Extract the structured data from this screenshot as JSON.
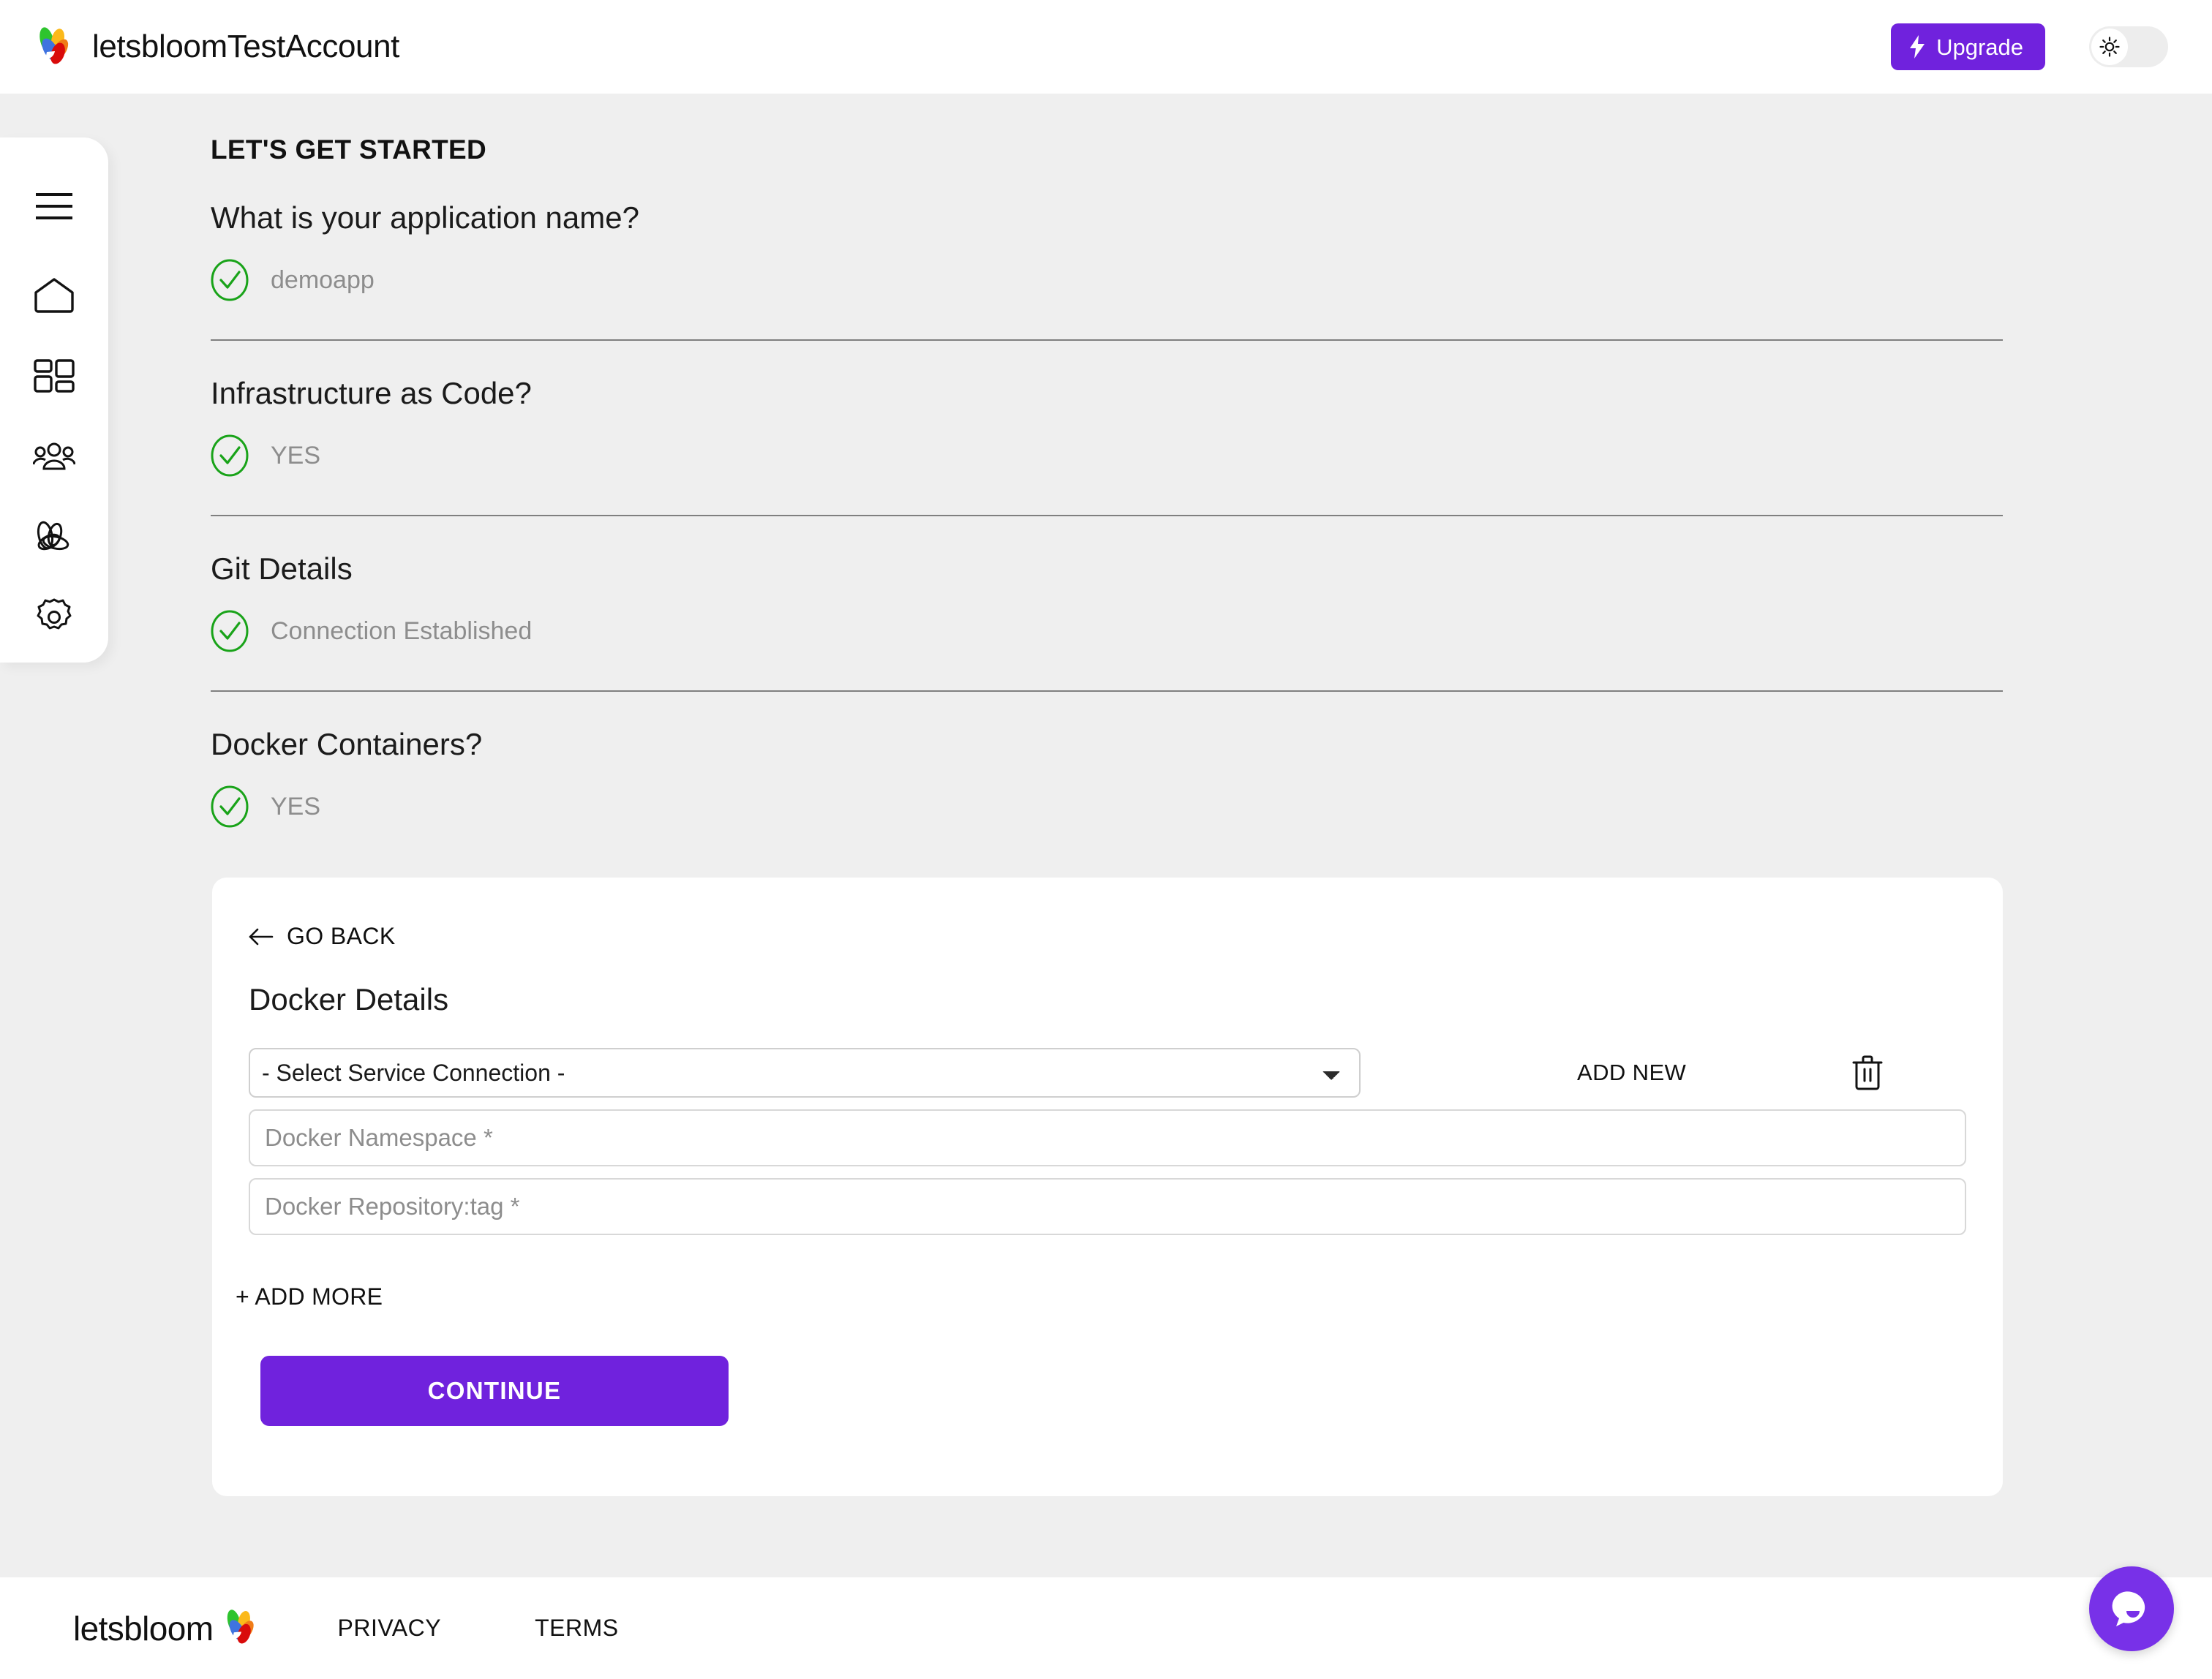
{
  "header": {
    "brand_name": "letsbloomTestAccount",
    "logo_icon": "bloom-petals-logo",
    "upgrade_label": "Upgrade",
    "upgrade_icon": "lightning-bolt-icon",
    "theme_toggle_icon": "sun-icon",
    "theme_toggle_state": "light"
  },
  "sidebar": {
    "items": [
      {
        "name": "menu",
        "icon": "hamburger-menu-icon"
      },
      {
        "name": "home",
        "icon": "home-icon"
      },
      {
        "name": "dashboard",
        "icon": "grid-dashboard-icon"
      },
      {
        "name": "teams",
        "icon": "users-group-icon"
      },
      {
        "name": "blooms",
        "icon": "bloom-petals-icon"
      },
      {
        "name": "settings",
        "icon": "gear-icon"
      }
    ]
  },
  "main": {
    "page_title": "LET'S GET STARTED",
    "sections": [
      {
        "question": "What is your application name?",
        "status_icon": "green-check-circle-icon",
        "answer": "demoapp",
        "divider_after": true
      },
      {
        "question": "Infrastructure as Code?",
        "status_icon": "green-check-circle-icon",
        "answer": "YES",
        "divider_after": true
      },
      {
        "question": "Git Details",
        "status_icon": "green-check-circle-icon",
        "answer": "Connection Established",
        "divider_after": true
      },
      {
        "question": "Docker Containers?",
        "status_icon": "green-check-circle-icon",
        "answer": "YES",
        "divider_after": false
      }
    ]
  },
  "docker_card": {
    "go_back_label": "GO BACK",
    "go_back_icon": "arrow-left-icon",
    "title": "Docker Details",
    "service_connection": {
      "selected": "- Select Service Connection -",
      "options": [
        "- Select Service Connection -"
      ]
    },
    "add_new_label": "ADD NEW",
    "delete_icon": "trash-icon",
    "namespace_placeholder": "Docker Namespace *",
    "namespace_value": "",
    "repository_placeholder": "Docker Repository:tag *",
    "repository_value": "",
    "add_more_label": "+ ADD MORE",
    "continue_label": "CONTINUE"
  },
  "footer": {
    "brand_word": "letsbloom",
    "logo_icon": "bloom-petals-logo",
    "privacy_label": "PRIVACY",
    "terms_label": "TERMS"
  },
  "chat": {
    "icon": "chat-bubble-smile-icon"
  },
  "colors": {
    "accent_purple": "#7022dd",
    "chat_purple": "#7831e8",
    "success_green": "#19a319",
    "page_bg": "#efefef",
    "surface_white": "#ffffff",
    "muted_text": "#8d8d8d",
    "divider": "#6b6b6b"
  }
}
